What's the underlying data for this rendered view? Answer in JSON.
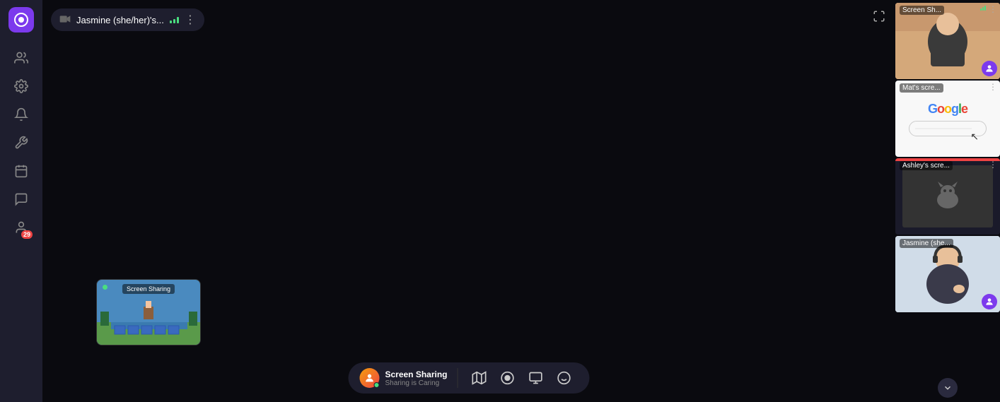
{
  "sidebar": {
    "logo_icon": "★",
    "items": [
      {
        "name": "people-icon",
        "icon": "👥",
        "label": "People"
      },
      {
        "name": "settings-icon",
        "icon": "⚙",
        "label": "Settings"
      },
      {
        "name": "bell-icon",
        "icon": "🔔",
        "label": "Notifications"
      },
      {
        "name": "tools-icon",
        "icon": "🔧",
        "label": "Tools"
      },
      {
        "name": "calendar-icon",
        "icon": "📅",
        "label": "Calendar"
      },
      {
        "name": "chat-icon",
        "icon": "💬",
        "label": "Chat"
      },
      {
        "name": "group-icon",
        "icon": "👤",
        "label": "Group",
        "badge": "29"
      }
    ]
  },
  "top_bar": {
    "participant_name": "Jasmine (she/her)'s...",
    "more_label": "⋮"
  },
  "mini_tile": {
    "label": "Screen Sharing"
  },
  "bottom_toolbar": {
    "screen_share_title": "Screen Sharing",
    "screen_share_subtitle": "Sharing is Caring",
    "btn_map": "🗺",
    "btn_record": "⏺",
    "btn_screen": "🖥",
    "btn_emoji": "🙂"
  },
  "right_panel": {
    "tiles": [
      {
        "label": "Screen Sh...",
        "type": "person",
        "has_signal": true,
        "has_more": true,
        "has_avatar": true,
        "avatar_bg": "#7c3aed"
      },
      {
        "label": "Mat's scre...",
        "type": "google",
        "has_signal": false,
        "has_more": true,
        "has_avatar": false
      },
      {
        "label": "Ashley's scre...",
        "type": "cat",
        "has_signal": false,
        "has_more": true,
        "has_avatar": false,
        "has_red_bar": true
      },
      {
        "label": "Jasmine (she...",
        "type": "jasmine",
        "has_signal": false,
        "has_more": false,
        "has_avatar": true,
        "avatar_bg": "#7c3aed"
      }
    ]
  }
}
